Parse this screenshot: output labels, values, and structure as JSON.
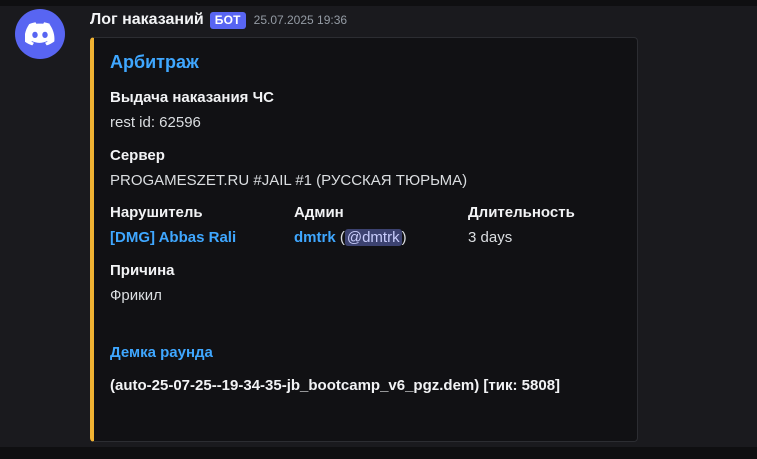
{
  "message": {
    "avatar_icon": "discord-logo-icon",
    "avatar_color": "#5865f2",
    "author": "Лог наказаний",
    "bot_tag": "БОТ",
    "timestamp": "25.07.2025 19:36"
  },
  "embed": {
    "accent_color": "#f0b232",
    "title": "Арбитраж",
    "fields": {
      "issue": {
        "name": "Выдача наказания ЧС",
        "value": "rest id: 62596"
      },
      "server": {
        "name": "Сервер",
        "value": "PROGAMESZET.RU #JAIL #1 (РУССКАЯ ТЮРЬМА)"
      },
      "offender": {
        "name": "Нарушитель",
        "value": "[DMG] Abbas Rali"
      },
      "admin": {
        "name": "Админ",
        "value": "dmtrk",
        "open_paren": " (",
        "mention": "@dmtrk",
        "close_paren": ")"
      },
      "duration": {
        "name": "Длительность",
        "value": "3 days"
      },
      "reason": {
        "name": "Причина",
        "value": "Фрикил"
      }
    },
    "demo": {
      "title": "Демка раунда",
      "file": "(auto-25-07-25--19-34-35-jb_bootcamp_v6_pgz.dem) [тик: 5808]"
    }
  }
}
